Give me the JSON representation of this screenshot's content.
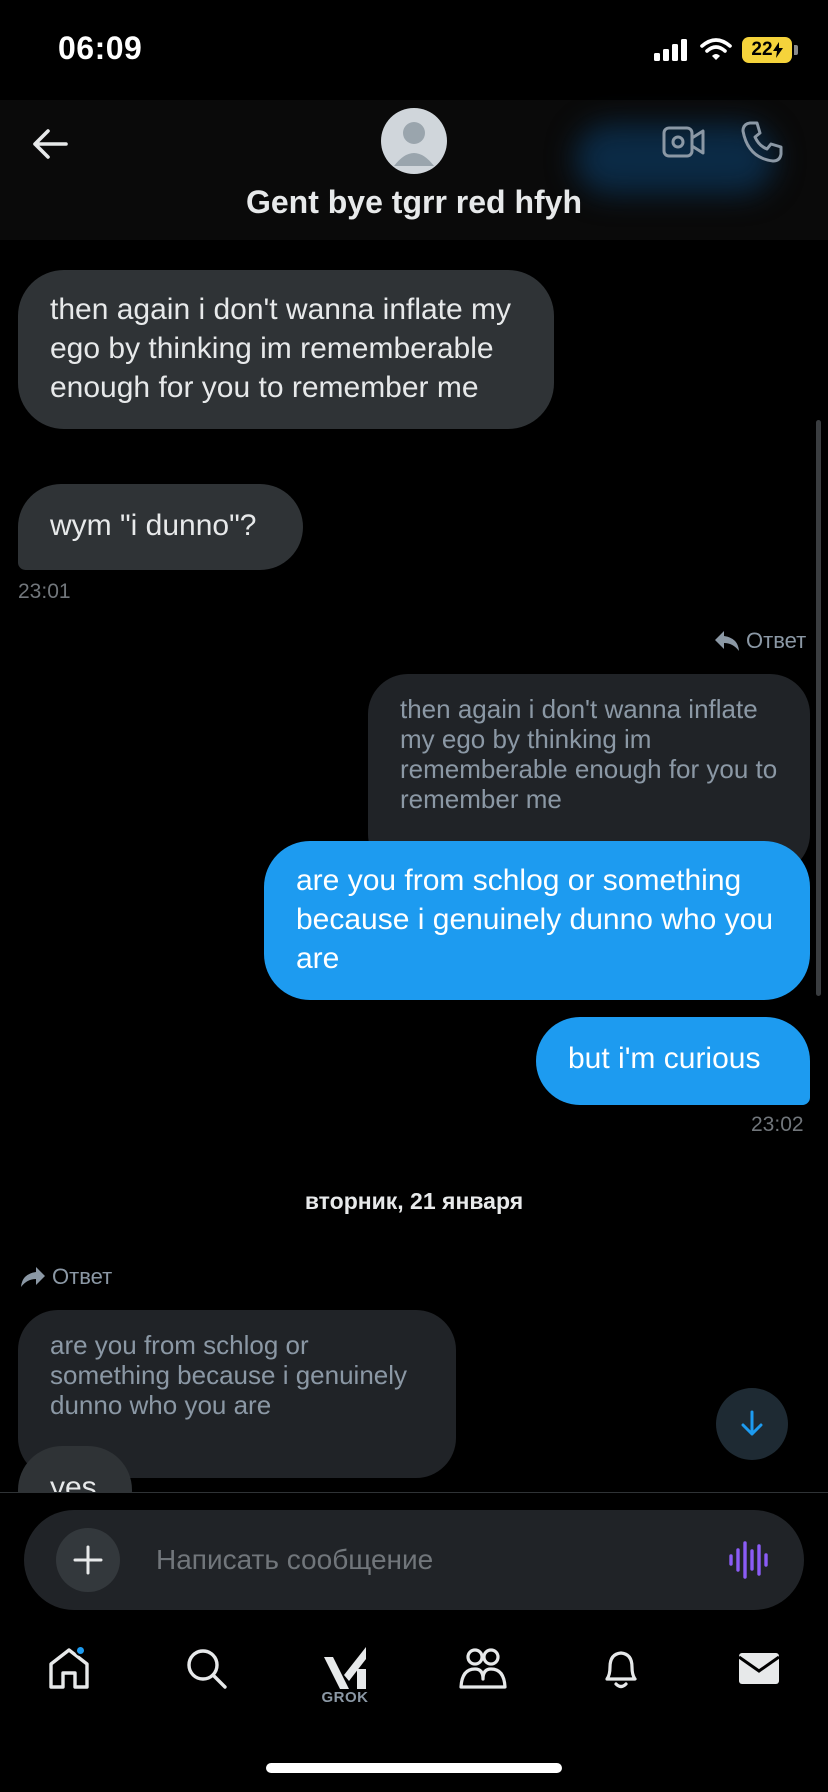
{
  "status_bar": {
    "time": "06:09",
    "battery": "22"
  },
  "header": {
    "contact_name": "Gent bye tgrr red hfyh"
  },
  "messages": [
    {
      "text": "then again i don't wanna inflate my ego by thinking im rememberable enough for you to remember me"
    },
    {
      "text": "wym \"i dunno\"?"
    },
    {
      "time": "23:01"
    },
    {
      "reply_label": "Ответ",
      "quote": "then again i don't wanna inflate my ego by thinking im rememberable enough for you to remember me",
      "text": "are you from schlog or something because i genuinely dunno who you are"
    },
    {
      "text": "but i'm curious"
    },
    {
      "time": "23:02"
    },
    {
      "date": "вторник, 21 января"
    },
    {
      "reply_label": "Ответ",
      "quote": "are you from schlog or something because i genuinely dunno who you are",
      "text": "yes"
    }
  ],
  "composer": {
    "placeholder": "Написать сообщение"
  },
  "bottom_nav": {
    "grok_label": "GROK"
  },
  "colors": {
    "accent": "#1d9bf0",
    "incoming_bubble": "#2f3336",
    "background": "#000000",
    "voice_icon": "#8b5cf6"
  },
  "icons": [
    "back-arrow-icon",
    "video-call-icon",
    "phone-icon",
    "reply-icon",
    "forward-icon",
    "arrow-down-icon",
    "plus-icon",
    "voice-wave-icon",
    "home-icon",
    "search-icon",
    "grok-icon",
    "communities-icon",
    "bell-icon",
    "mail-icon"
  ]
}
